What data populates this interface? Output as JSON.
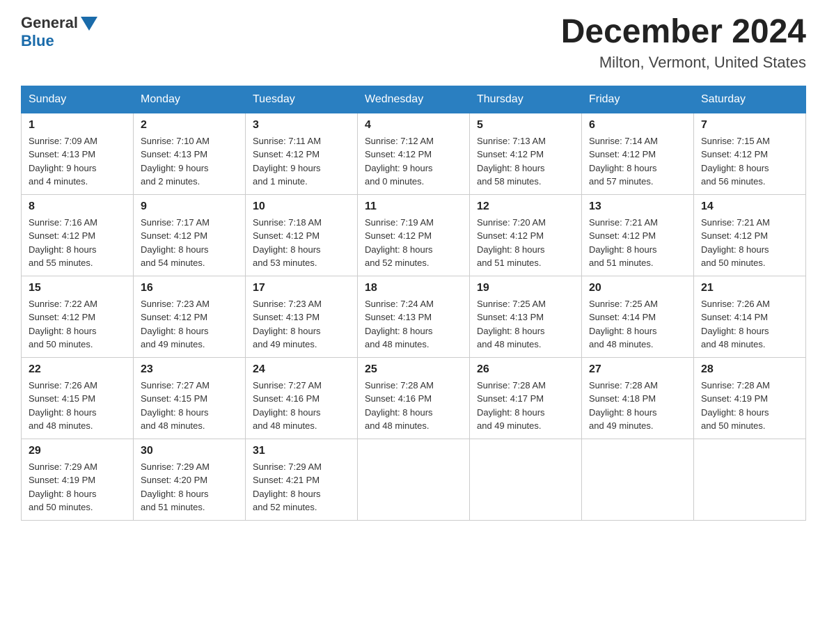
{
  "header": {
    "logo": {
      "general": "General",
      "blue": "Blue"
    },
    "title": "December 2024",
    "location": "Milton, Vermont, United States"
  },
  "days_of_week": [
    "Sunday",
    "Monday",
    "Tuesday",
    "Wednesday",
    "Thursday",
    "Friday",
    "Saturday"
  ],
  "weeks": [
    [
      {
        "day": "1",
        "sunrise": "7:09 AM",
        "sunset": "4:13 PM",
        "daylight": "9 hours and 4 minutes."
      },
      {
        "day": "2",
        "sunrise": "7:10 AM",
        "sunset": "4:13 PM",
        "daylight": "9 hours and 2 minutes."
      },
      {
        "day": "3",
        "sunrise": "7:11 AM",
        "sunset": "4:12 PM",
        "daylight": "9 hours and 1 minute."
      },
      {
        "day": "4",
        "sunrise": "7:12 AM",
        "sunset": "4:12 PM",
        "daylight": "9 hours and 0 minutes."
      },
      {
        "day": "5",
        "sunrise": "7:13 AM",
        "sunset": "4:12 PM",
        "daylight": "8 hours and 58 minutes."
      },
      {
        "day": "6",
        "sunrise": "7:14 AM",
        "sunset": "4:12 PM",
        "daylight": "8 hours and 57 minutes."
      },
      {
        "day": "7",
        "sunrise": "7:15 AM",
        "sunset": "4:12 PM",
        "daylight": "8 hours and 56 minutes."
      }
    ],
    [
      {
        "day": "8",
        "sunrise": "7:16 AM",
        "sunset": "4:12 PM",
        "daylight": "8 hours and 55 minutes."
      },
      {
        "day": "9",
        "sunrise": "7:17 AM",
        "sunset": "4:12 PM",
        "daylight": "8 hours and 54 minutes."
      },
      {
        "day": "10",
        "sunrise": "7:18 AM",
        "sunset": "4:12 PM",
        "daylight": "8 hours and 53 minutes."
      },
      {
        "day": "11",
        "sunrise": "7:19 AM",
        "sunset": "4:12 PM",
        "daylight": "8 hours and 52 minutes."
      },
      {
        "day": "12",
        "sunrise": "7:20 AM",
        "sunset": "4:12 PM",
        "daylight": "8 hours and 51 minutes."
      },
      {
        "day": "13",
        "sunrise": "7:21 AM",
        "sunset": "4:12 PM",
        "daylight": "8 hours and 51 minutes."
      },
      {
        "day": "14",
        "sunrise": "7:21 AM",
        "sunset": "4:12 PM",
        "daylight": "8 hours and 50 minutes."
      }
    ],
    [
      {
        "day": "15",
        "sunrise": "7:22 AM",
        "sunset": "4:12 PM",
        "daylight": "8 hours and 50 minutes."
      },
      {
        "day": "16",
        "sunrise": "7:23 AM",
        "sunset": "4:12 PM",
        "daylight": "8 hours and 49 minutes."
      },
      {
        "day": "17",
        "sunrise": "7:23 AM",
        "sunset": "4:13 PM",
        "daylight": "8 hours and 49 minutes."
      },
      {
        "day": "18",
        "sunrise": "7:24 AM",
        "sunset": "4:13 PM",
        "daylight": "8 hours and 48 minutes."
      },
      {
        "day": "19",
        "sunrise": "7:25 AM",
        "sunset": "4:13 PM",
        "daylight": "8 hours and 48 minutes."
      },
      {
        "day": "20",
        "sunrise": "7:25 AM",
        "sunset": "4:14 PM",
        "daylight": "8 hours and 48 minutes."
      },
      {
        "day": "21",
        "sunrise": "7:26 AM",
        "sunset": "4:14 PM",
        "daylight": "8 hours and 48 minutes."
      }
    ],
    [
      {
        "day": "22",
        "sunrise": "7:26 AM",
        "sunset": "4:15 PM",
        "daylight": "8 hours and 48 minutes."
      },
      {
        "day": "23",
        "sunrise": "7:27 AM",
        "sunset": "4:15 PM",
        "daylight": "8 hours and 48 minutes."
      },
      {
        "day": "24",
        "sunrise": "7:27 AM",
        "sunset": "4:16 PM",
        "daylight": "8 hours and 48 minutes."
      },
      {
        "day": "25",
        "sunrise": "7:28 AM",
        "sunset": "4:16 PM",
        "daylight": "8 hours and 48 minutes."
      },
      {
        "day": "26",
        "sunrise": "7:28 AM",
        "sunset": "4:17 PM",
        "daylight": "8 hours and 49 minutes."
      },
      {
        "day": "27",
        "sunrise": "7:28 AM",
        "sunset": "4:18 PM",
        "daylight": "8 hours and 49 minutes."
      },
      {
        "day": "28",
        "sunrise": "7:28 AM",
        "sunset": "4:19 PM",
        "daylight": "8 hours and 50 minutes."
      }
    ],
    [
      {
        "day": "29",
        "sunrise": "7:29 AM",
        "sunset": "4:19 PM",
        "daylight": "8 hours and 50 minutes."
      },
      {
        "day": "30",
        "sunrise": "7:29 AM",
        "sunset": "4:20 PM",
        "daylight": "8 hours and 51 minutes."
      },
      {
        "day": "31",
        "sunrise": "7:29 AM",
        "sunset": "4:21 PM",
        "daylight": "8 hours and 52 minutes."
      },
      null,
      null,
      null,
      null
    ]
  ],
  "labels": {
    "sunrise": "Sunrise:",
    "sunset": "Sunset:",
    "daylight": "Daylight:"
  }
}
